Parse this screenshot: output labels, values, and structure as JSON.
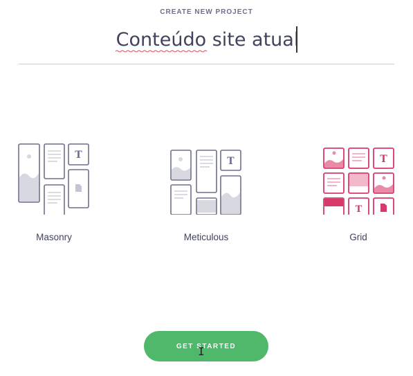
{
  "header": {
    "label": "CREATE NEW PROJECT"
  },
  "project": {
    "name": "Conteúdo site atual"
  },
  "layouts": [
    {
      "label": "Masonry",
      "selected": false
    },
    {
      "label": "Meticulous",
      "selected": false
    },
    {
      "label": "Grid",
      "selected": true
    }
  ],
  "tile_text_glyph": "T",
  "actions": {
    "get_started_label": "GET STARTED"
  },
  "colors": {
    "accent_selected": "#d9386a",
    "outline_default": "#6d6f8c",
    "cta": "#4fb86a",
    "text": "#40435d"
  }
}
